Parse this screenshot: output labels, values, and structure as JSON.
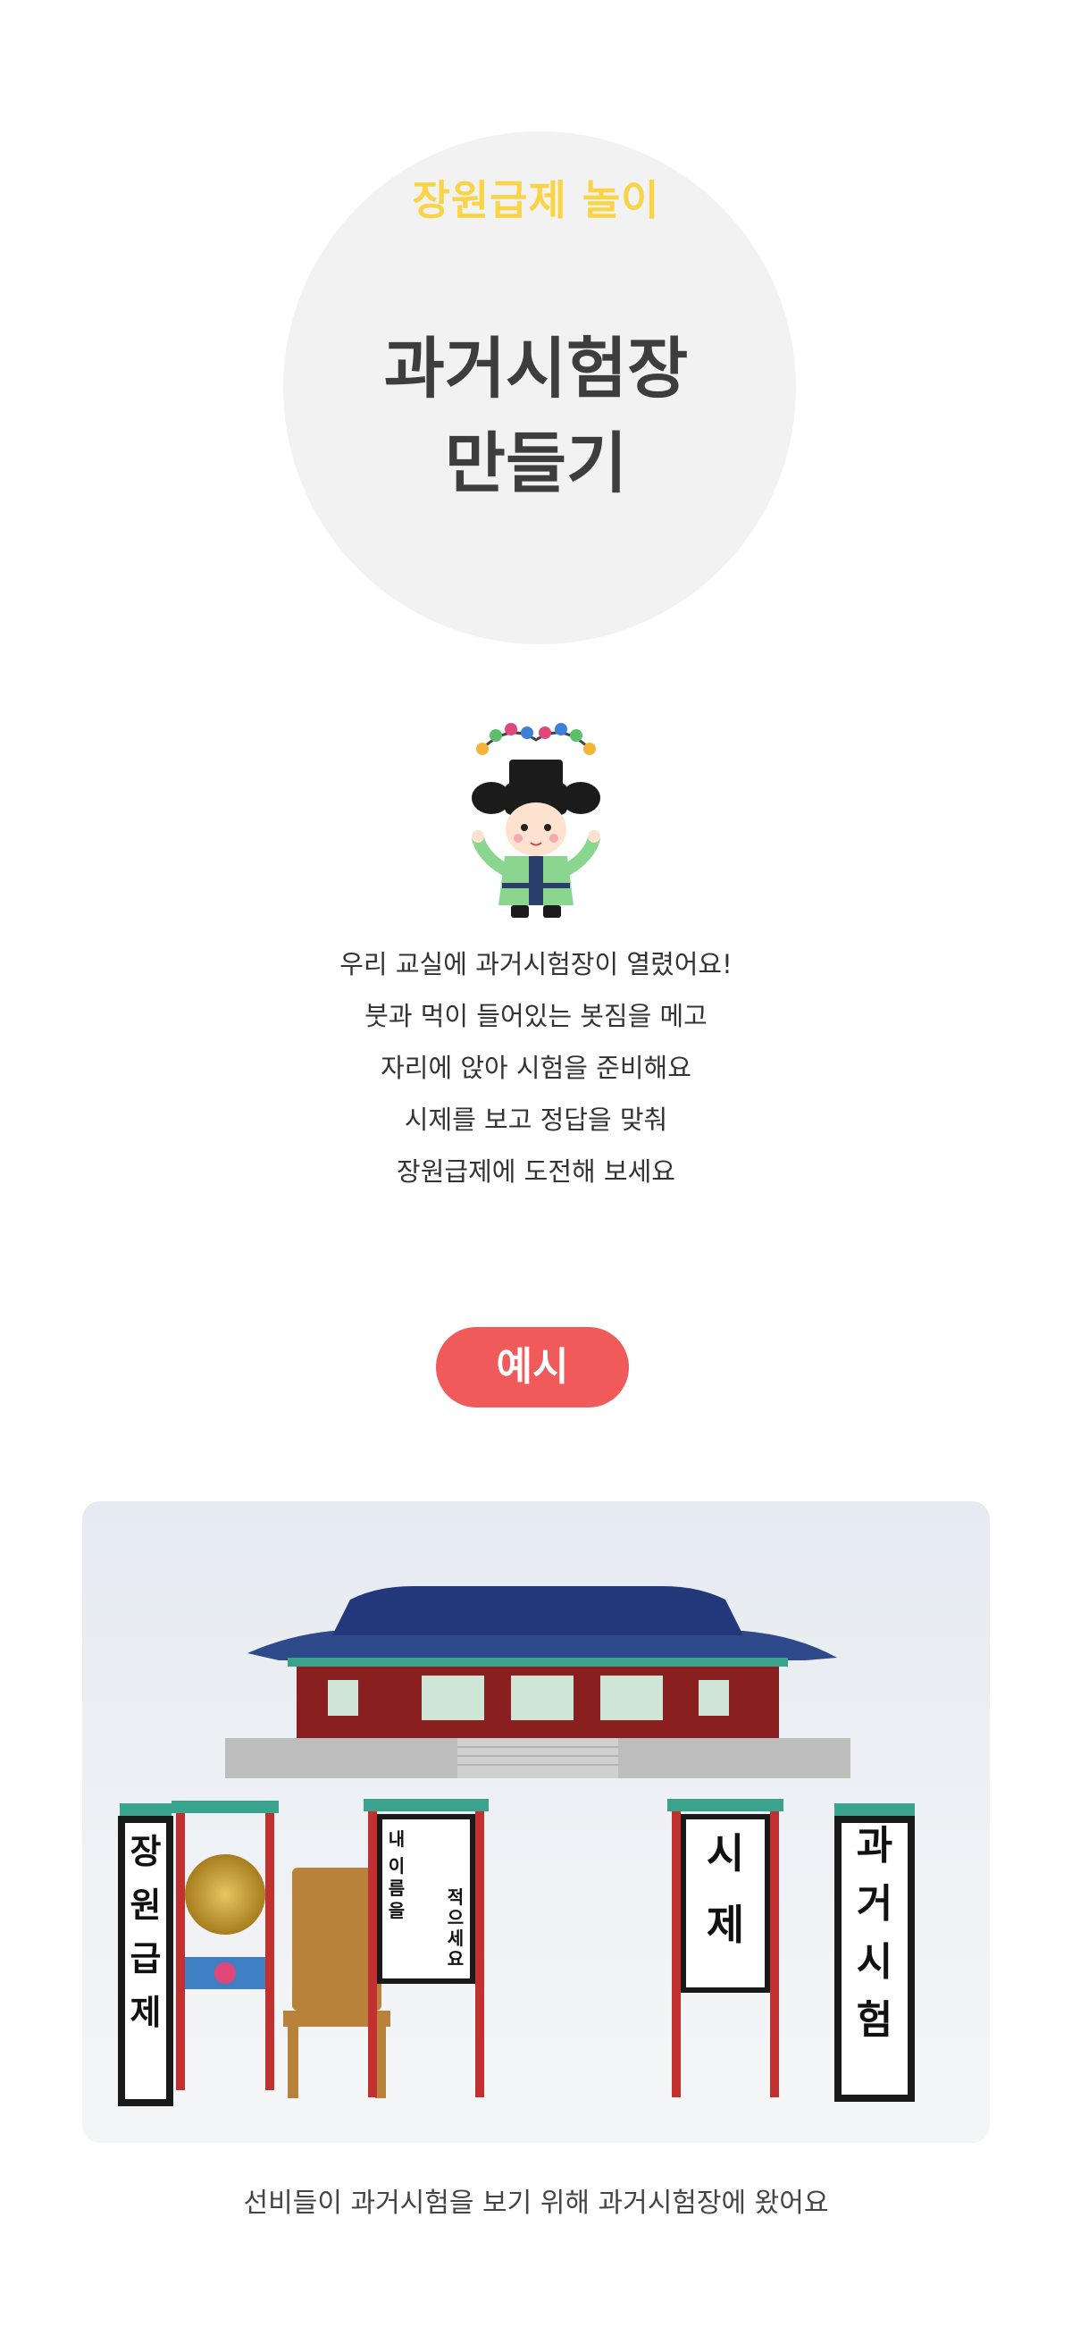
{
  "hero": {
    "subtitle": "장원급제 놀이",
    "title_line1": "과거시험장",
    "title_line2": "만들기"
  },
  "intro": {
    "lines": [
      "우리 교실에 과거시험장이 열렸어요!",
      "붓과 먹이 들어있는 봇짐을 메고",
      "자리에 앉아 시험을 준비해요",
      "시제를 보고 정답을 맞춰",
      "장원급제에 도전해 보세요"
    ]
  },
  "example": {
    "label": "예시"
  },
  "photo": {
    "banner_left": [
      "장",
      "원",
      "급",
      "제"
    ],
    "board_col1": [
      "내",
      "이",
      "름",
      "을"
    ],
    "board_col2": [
      "적",
      "으",
      "세",
      "요"
    ],
    "board_right1": [
      "시",
      "제"
    ],
    "banner_right": [
      "과",
      "거",
      "시",
      "험"
    ]
  },
  "caption": "선비들이 과거시험을 보기 위해 과거시험장에 왔어요",
  "colors": {
    "accent_yellow": "#f9d447",
    "pill_red": "#f05a5a",
    "title_gray": "#3d3d3d"
  }
}
